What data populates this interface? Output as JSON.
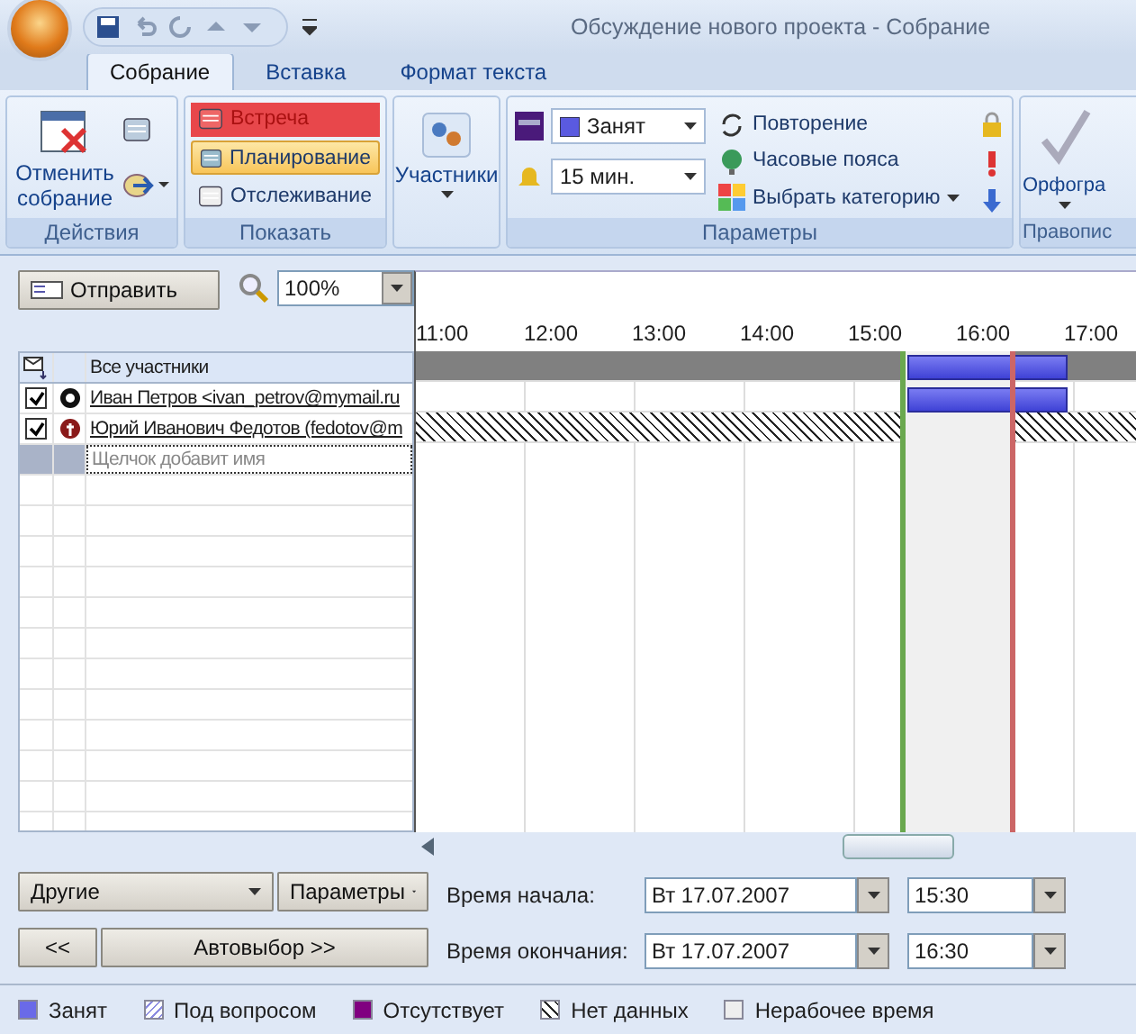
{
  "window": {
    "title": "Обсуждение нового проекта - Собрание"
  },
  "tabs": [
    {
      "label": "Собрание",
      "selected": true
    },
    {
      "label": "Вставка",
      "selected": false
    },
    {
      "label": "Формат текста",
      "selected": false
    }
  ],
  "ribbon": {
    "actions": {
      "label": "Действия",
      "cancel": "Отменить собрание"
    },
    "show": {
      "label": "Показать",
      "items": [
        {
          "label": "Встреча",
          "selected": false,
          "highlighted": true
        },
        {
          "label": "Планирование",
          "selected": true,
          "highlighted": false
        },
        {
          "label": "Отслеживание",
          "selected": false,
          "highlighted": false
        }
      ]
    },
    "attendees": {
      "label": "Участники"
    },
    "options": {
      "label": "Параметры",
      "show_as": "Занят",
      "reminder": "15 мин.",
      "recurrence": "Повторение",
      "time_zones": "Часовые пояса",
      "categorize": "Выбрать категорию"
    },
    "proofing": {
      "label": "Правопис",
      "spelling": "Орфогра"
    }
  },
  "toolbar": {
    "send": "Отправить",
    "zoom": "100%"
  },
  "attendee_list": {
    "header": "Все участники",
    "add_placeholder": "Щелчок добавит имя",
    "rows": [
      {
        "name": "Иван Петров <ivan_petrov@mymail.ru",
        "checked": true,
        "kind": "organizer",
        "busy": true,
        "no_data": false
      },
      {
        "name": "Юрий Иванович Федотов (fedotov@m",
        "checked": true,
        "kind": "required",
        "busy": false,
        "no_data": true
      }
    ]
  },
  "timeline": {
    "hours": [
      "11:00",
      "12:00",
      "13:00",
      "14:00",
      "15:00",
      "16:00",
      "17:00"
    ]
  },
  "buttons": {
    "other": "Другие",
    "options": "Параметры",
    "prev": "<<",
    "autopick": "Автовыбор >>"
  },
  "start": {
    "label": "Время начала:",
    "date": "Вт 17.07.2007",
    "time": "15:30"
  },
  "end": {
    "label": "Время окончания:",
    "date": "Вт 17.07.2007",
    "time": "16:30"
  },
  "legend": [
    {
      "label": "Занят",
      "kind": "busy"
    },
    {
      "label": "Под вопросом",
      "kind": "tentative"
    },
    {
      "label": "Отсутствует",
      "kind": "away"
    },
    {
      "label": "Нет данных",
      "kind": "no_data"
    },
    {
      "label": "Нерабочее время",
      "kind": "off_hours"
    }
  ]
}
